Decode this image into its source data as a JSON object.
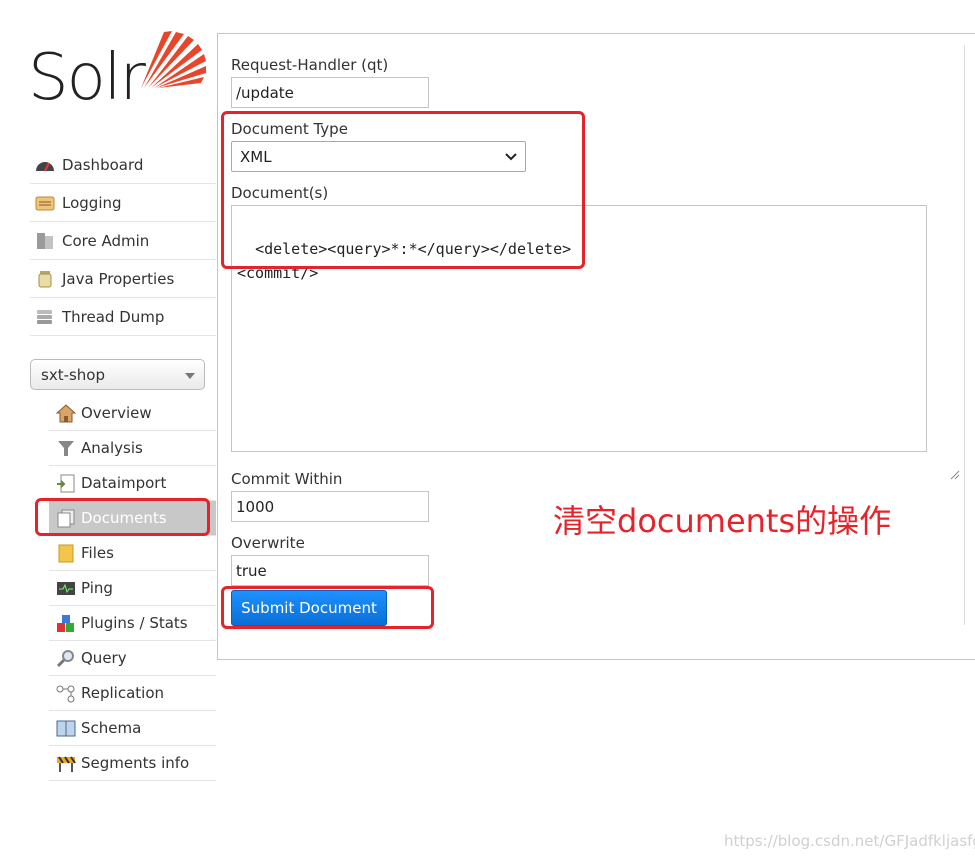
{
  "brand": {
    "name": "Solr",
    "accent_color": "#e8462b"
  },
  "nav": {
    "items": [
      {
        "label": "Dashboard",
        "icon": "dashboard-gauge-icon"
      },
      {
        "label": "Logging",
        "icon": "logging-page-icon"
      },
      {
        "label": "Core Admin",
        "icon": "core-admin-server-icon"
      },
      {
        "label": "Java Properties",
        "icon": "java-jar-icon"
      },
      {
        "label": "Thread Dump",
        "icon": "thread-stack-icon"
      }
    ]
  },
  "core_selector": {
    "selected": "sxt-shop"
  },
  "core_menu": {
    "items": [
      {
        "label": "Overview",
        "icon": "house-icon"
      },
      {
        "label": "Analysis",
        "icon": "funnel-icon"
      },
      {
        "label": "Dataimport",
        "icon": "import-page-icon"
      },
      {
        "label": "Documents",
        "icon": "documents-icon",
        "active": true
      },
      {
        "label": "Files",
        "icon": "folder-icon"
      },
      {
        "label": "Ping",
        "icon": "monitor-pulse-icon"
      },
      {
        "label": "Plugins / Stats",
        "icon": "plugin-blocks-icon"
      },
      {
        "label": "Query",
        "icon": "magnifier-icon"
      },
      {
        "label": "Replication",
        "icon": "replication-nodes-icon"
      },
      {
        "label": "Schema",
        "icon": "book-icon"
      },
      {
        "label": "Segments info",
        "icon": "construction-barrier-icon"
      }
    ]
  },
  "form": {
    "request_handler_label": "Request-Handler (qt)",
    "request_handler_value": "/update",
    "document_type_label": "Document Type",
    "document_type_value": "XML",
    "documents_label": "Document(s)",
    "documents_value": "<delete><query>*:*</query></delete>\n<commit/>",
    "commit_within_label": "Commit Within",
    "commit_within_value": "1000",
    "overwrite_label": "Overwrite",
    "overwrite_value": "true",
    "submit_label": "Submit Document"
  },
  "annotation": {
    "caption": "清空documents的操作",
    "color": "#e6232a"
  },
  "watermark": "https://blog.csdn.net/GFJadfkljasfg"
}
